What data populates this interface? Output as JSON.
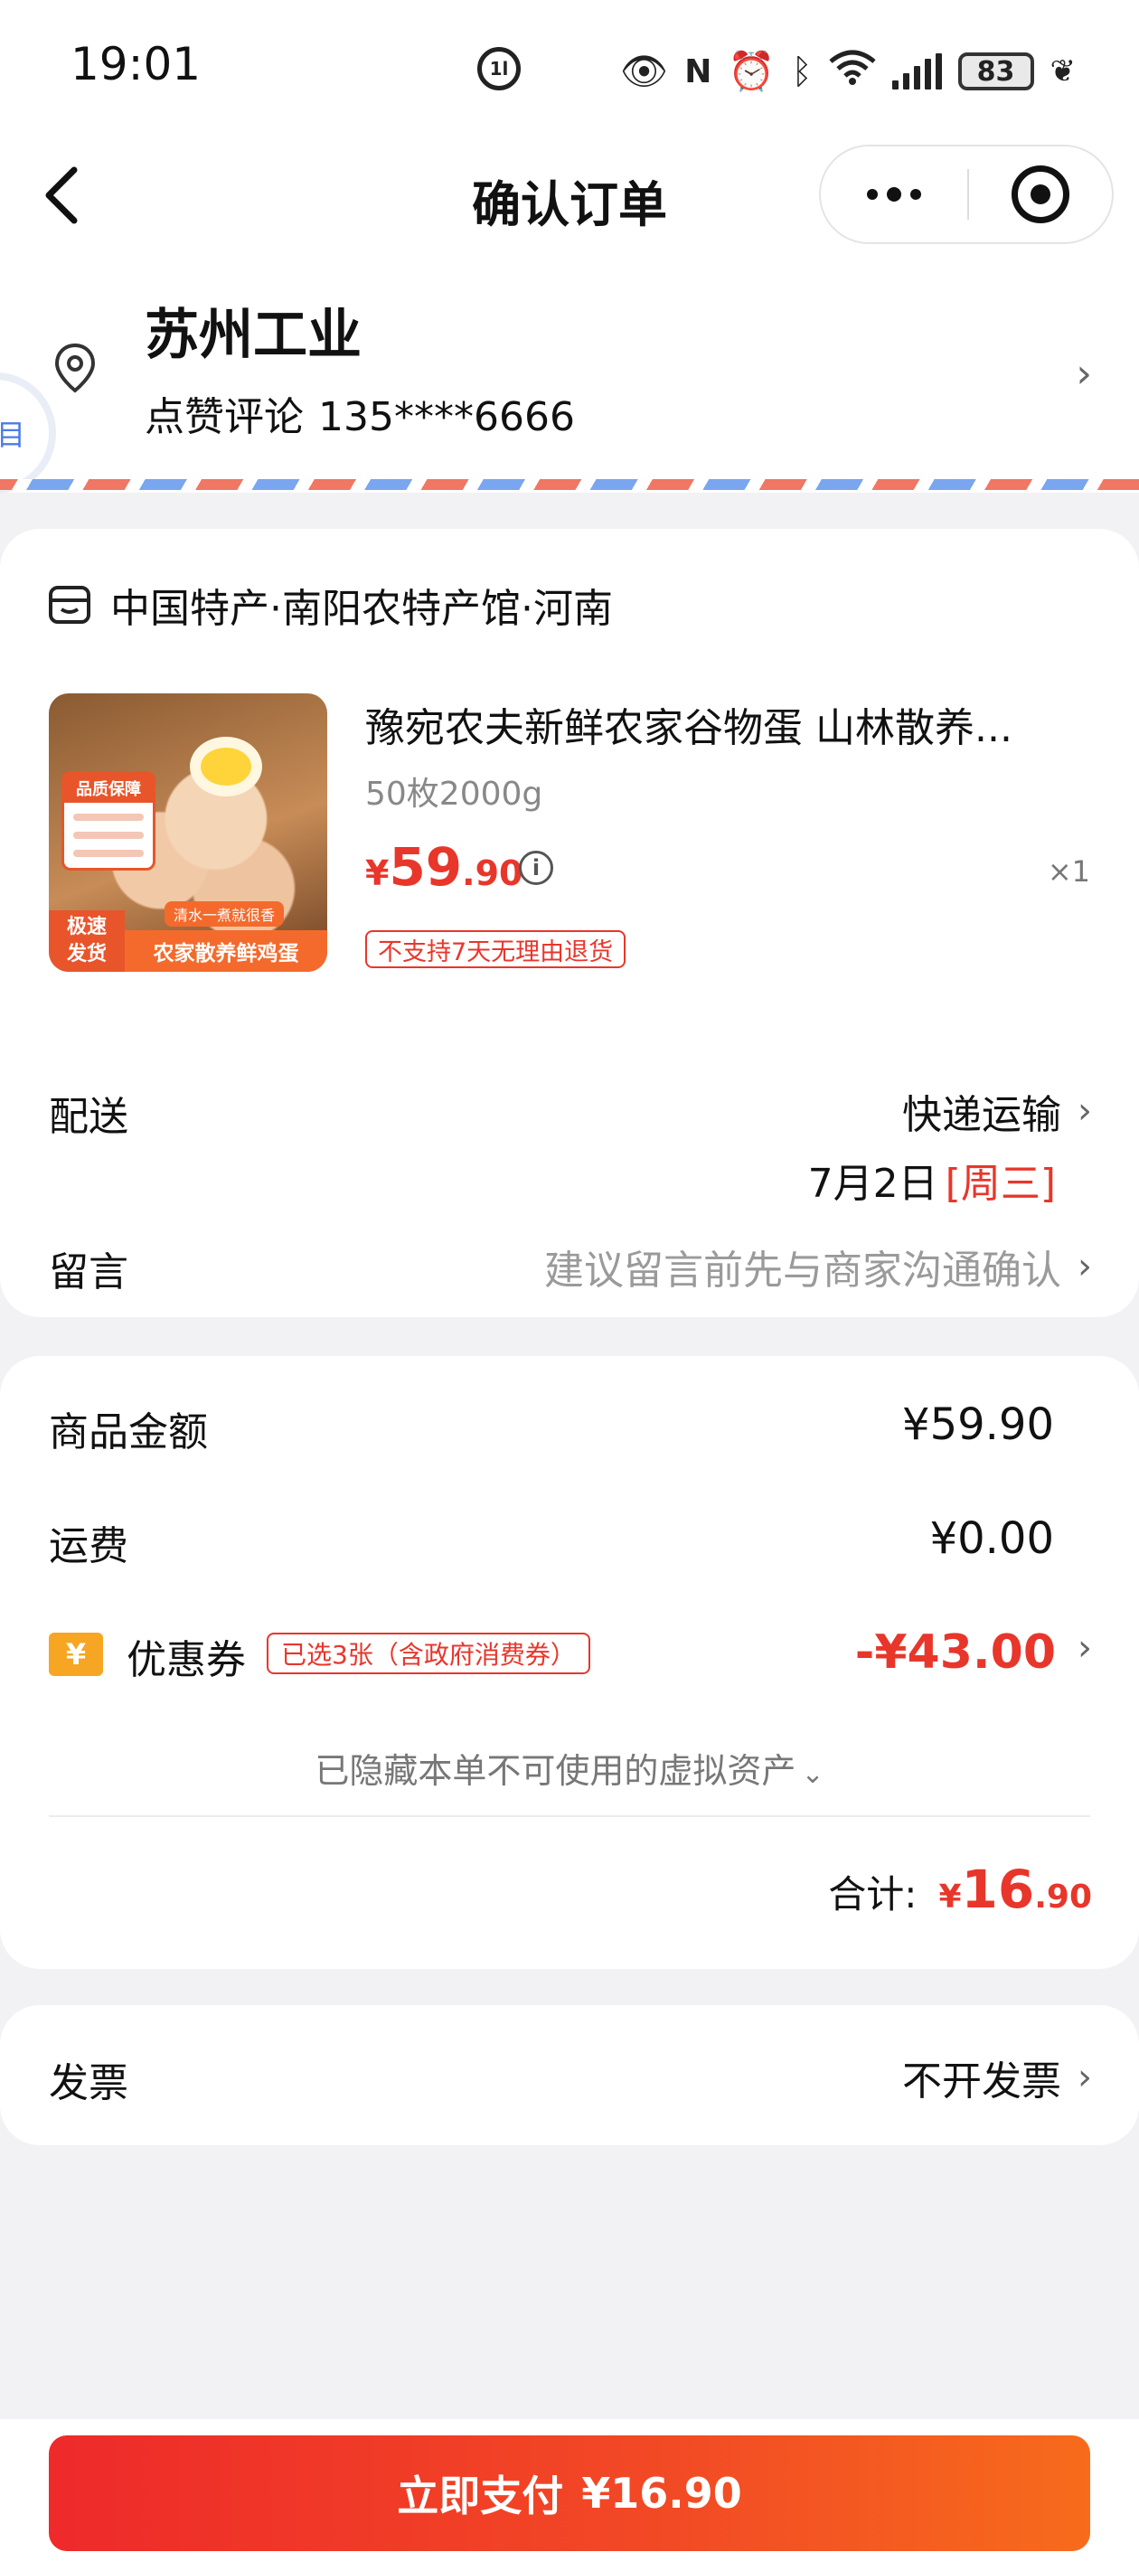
{
  "status_bar": {
    "time": "19:01",
    "center_badge": "1l",
    "battery": "83"
  },
  "nav": {
    "title": "确认订单"
  },
  "address": {
    "name": "苏州工业",
    "contact_name": "点赞评论",
    "phone": "135****6666",
    "side_tab_text": "目"
  },
  "shop": {
    "name": "中国特产·南阳农特产馆·河南"
  },
  "product": {
    "title": "豫宛农夫新鲜农家谷物蛋 山林散养...",
    "spec": "50枚2000g",
    "price_symbol": "¥",
    "price_int": "59",
    "price_dec": ".90",
    "quantity": "×1",
    "return_policy": "不支持7天无理由退货",
    "image_text": {
      "quality": "品质保障",
      "speed_line1": "极速",
      "speed_line2": "发货",
      "banner": "农家散养鲜鸡蛋",
      "tagline": "清水一煮就很香"
    }
  },
  "delivery": {
    "label": "配送",
    "method": "快递运输",
    "date": "7月2日",
    "weekday": "[周三]"
  },
  "note": {
    "label": "留言",
    "placeholder": "建议留言前先与商家沟通确认"
  },
  "amounts": {
    "goods_label": "商品金额",
    "goods_value": "¥59.90",
    "shipping_label": "运费",
    "shipping_value": "¥0.00",
    "coupon_icon": "¥",
    "coupon_label": "优惠券",
    "coupon_tag": "已选3张（含政府消费券）",
    "coupon_value": "-¥43.00",
    "hidden_note": "已隐藏本单不可使用的虚拟资产",
    "total_label": "合计:",
    "total_symbol": "¥",
    "total_int": "16",
    "total_dec": ".90"
  },
  "invoice": {
    "label": "发票",
    "value": "不开发票"
  },
  "footer": {
    "pay_label": "立即支付",
    "pay_amount": "¥16.90"
  },
  "colors": {
    "accent_red": "#e8362b",
    "pay_gradient_start": "#ee2a2a",
    "pay_gradient_end": "#f76b1c",
    "coupon_icon_bg": "#f6a623"
  }
}
